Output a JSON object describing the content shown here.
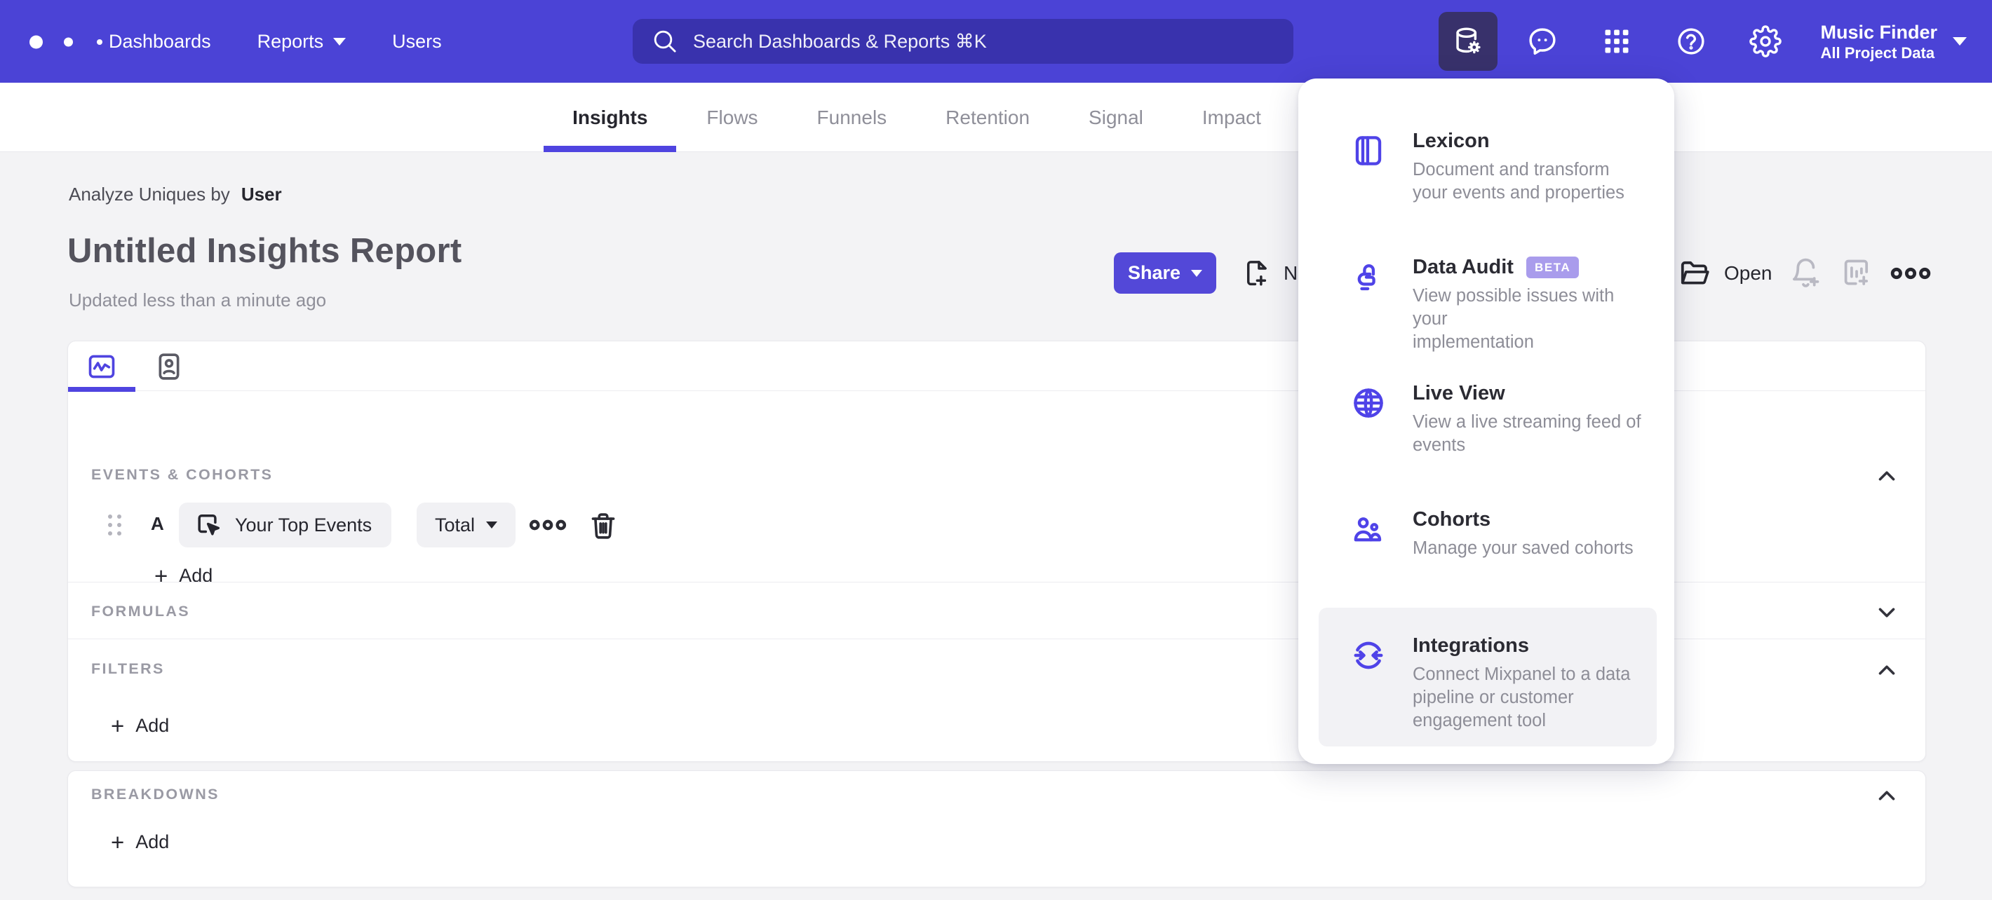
{
  "colors": {
    "nav_background": "#4b43d6",
    "nav_active_icon_background": "#38316b",
    "accent_purple": "#4f44e0",
    "share_button": "#5348d8",
    "beta_badge": "#a99cec",
    "page_background": "#f3f3f5"
  },
  "topnav": {
    "links": [
      {
        "label": "Dashboards"
      },
      {
        "label": "Reports"
      },
      {
        "label": "Users"
      }
    ],
    "search": {
      "placeholder": "Search Dashboards & Reports ⌘K"
    },
    "project": {
      "name": "Music Finder",
      "scope": "All Project Data"
    }
  },
  "report_tabs": [
    {
      "label": "Insights"
    },
    {
      "label": "Flows"
    },
    {
      "label": "Funnels"
    },
    {
      "label": "Retention"
    },
    {
      "label": "Signal"
    },
    {
      "label": "Impact"
    }
  ],
  "header": {
    "analyze_prefix": "Analyze Uniques by",
    "analyze_value": "User",
    "title": "Untitled Insights Report",
    "updated": "Updated less than a minute ago",
    "share_label": "Share",
    "new_label": "New",
    "open_label": "Open"
  },
  "builder": {
    "events": {
      "label": "EVENTS & COHORTS",
      "row": {
        "letter": "A",
        "event": "Your Top Events",
        "aggregation": "Total"
      },
      "add_label": "Add"
    },
    "formulas": {
      "label": "FORMULAS"
    },
    "filters": {
      "label": "FILTERS",
      "add_label": "Add"
    },
    "breakdowns": {
      "label": "BREAKDOWNS",
      "add_label": "Add"
    }
  },
  "menu": {
    "items": [
      {
        "title": "Lexicon",
        "desc1": "Document and transform",
        "desc2": "your events and properties"
      },
      {
        "title": "Data Audit",
        "badge": "BETA",
        "desc1": "View possible issues with your",
        "desc2": "implementation"
      },
      {
        "title": "Live View",
        "desc1": "View a live streaming feed of",
        "desc2": "events"
      },
      {
        "title": "Cohorts",
        "desc1": "Manage your saved cohorts"
      },
      {
        "title": "Integrations",
        "desc1": "Connect Mixpanel to a data",
        "desc2": "pipeline or customer",
        "desc3": "engagement tool"
      }
    ]
  }
}
